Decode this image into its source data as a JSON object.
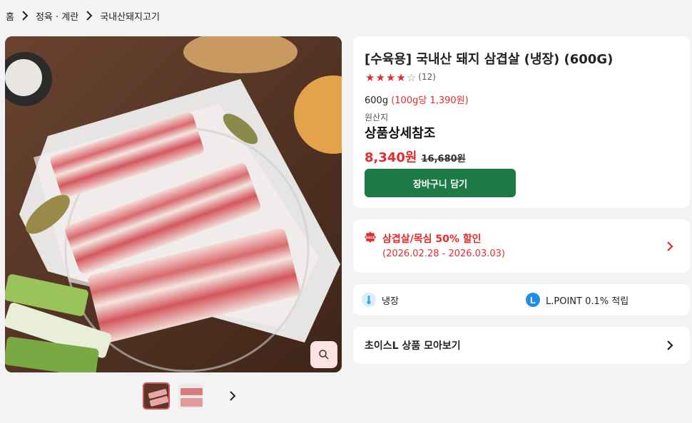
{
  "breadcrumb": {
    "items": [
      "홈",
      "정육 · 계란",
      "국내산돼지고기"
    ]
  },
  "product": {
    "title": "[수육용] 국내산 돼지 삼겹살 (냉장) (600G)",
    "rating": 4,
    "rating_max": 5,
    "review_count": "(12)",
    "weight": "600g",
    "unit_price": "(100g당 1,390원)",
    "origin_label": "원산지",
    "origin_value": "상품상세참조",
    "sale_price": "8,340원",
    "original_price": "16,680원",
    "cart_button": "장바구니 담기"
  },
  "gallery": {
    "zoom_icon": "magnifier-icon",
    "thumb_count": 2,
    "active_thumb": 0,
    "next_icon": "chevron-right-icon"
  },
  "promo": {
    "icon": "sale-badge-icon",
    "icon_text": "SALE",
    "title": "삼겹살/목심 50% 할인",
    "date": "(2026.02.28 - 2026.03.03)"
  },
  "benefits": {
    "storage_icon": "thermometer-icon",
    "storage": "냉장",
    "point_icon_letter": "L",
    "point": "L.POINT 0.1% 적립"
  },
  "choice": {
    "label": "초이스L 상품 모아보기"
  },
  "colors": {
    "accent_red": "#e42b2b",
    "cart_green": "#1c7a45",
    "lpoint_blue": "#1f8ee8",
    "background": "#f3f3f5"
  }
}
